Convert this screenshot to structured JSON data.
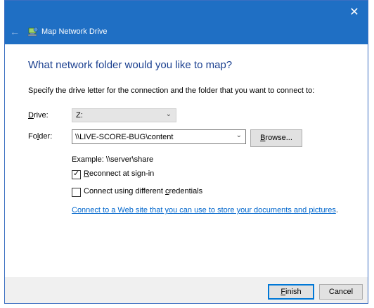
{
  "titlebar": {
    "title": "Map Network Drive",
    "close_glyph": "✕",
    "back_glyph": "←",
    "color": "#1f6fc4"
  },
  "heading": "What network folder would you like to map?",
  "intro": "Specify the drive letter for the connection and the folder that you want to connect to:",
  "drive": {
    "label_first": "D",
    "label_rest": "rive:",
    "value": "Z:"
  },
  "folder": {
    "label_first": "Fo",
    "label_key": "l",
    "label_rest": "der:",
    "value": "\\\\LIVE-SCORE-BUG\\content",
    "browse_label_key": "B",
    "browse_label_rest": "rowse..."
  },
  "example": "Example: \\\\server\\share",
  "reconnect": {
    "checked": true,
    "label_key": "R",
    "label_rest": "econnect at sign-in"
  },
  "credentials": {
    "checked": false,
    "label_before": "Connect using different ",
    "label_key": "c",
    "label_rest": "redentials"
  },
  "link": "Connect to a Web site that you can use to store your documents and pictures",
  "link_suffix": ".",
  "footer": {
    "finish_key": "F",
    "finish_rest": "inish",
    "cancel": "Cancel"
  },
  "icons": {
    "app": "network-drive-icon",
    "close": "close-icon",
    "back": "back-arrow-icon",
    "chevron": "chevron-down-icon",
    "check": "checkmark-icon"
  }
}
